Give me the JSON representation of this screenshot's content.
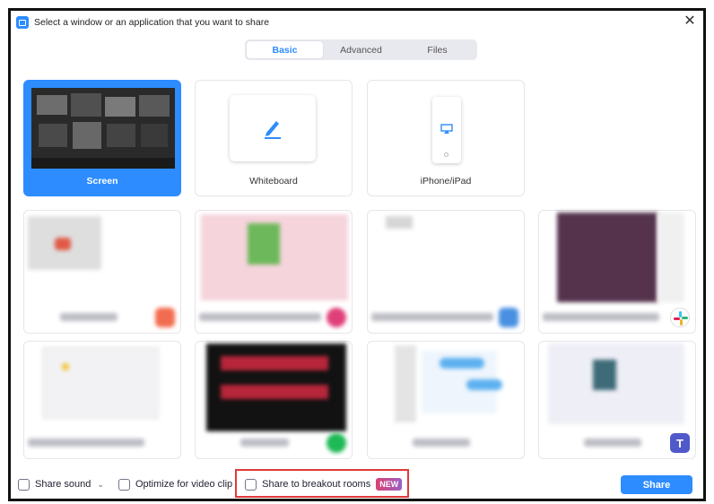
{
  "window": {
    "title": "Select a window or an application that you want to share",
    "close_glyph": "✕"
  },
  "tabs": [
    {
      "label": "Basic",
      "active": true
    },
    {
      "label": "Advanced",
      "active": false
    },
    {
      "label": "Files",
      "active": false
    }
  ],
  "basic_sources": [
    {
      "label": "Screen",
      "selected": true,
      "icon": "screen-thumbnail"
    },
    {
      "label": "Whiteboard",
      "selected": false,
      "icon": "pen-icon"
    },
    {
      "label": "iPhone/iPad",
      "selected": false,
      "icon": "airplay-icon"
    }
  ],
  "app_windows": [
    {
      "icon": "app-icon-orange",
      "color": "#f26c4f"
    },
    {
      "icon": "app-icon-pink",
      "color": "#e0407a"
    },
    {
      "icon": "app-icon-blue",
      "color": "#4a90e2"
    },
    {
      "icon": "slack-icon",
      "color": "#611f69"
    },
    {
      "icon": "chrome-icon",
      "color": "#e9e9ee"
    },
    {
      "icon": "spotify-icon",
      "color": "#1db954"
    },
    {
      "icon": "app-icon-none",
      "color": "#ffffff"
    },
    {
      "icon": "teams-icon",
      "color": "#5059c9"
    }
  ],
  "options": {
    "share_sound": "Share sound",
    "optimize_video": "Optimize for video clip",
    "breakout_rooms": "Share to breakout rooms",
    "new_badge": "NEW"
  },
  "share_button": "Share",
  "colors": {
    "accent": "#2d8cff",
    "highlight": "#e03a3a"
  }
}
